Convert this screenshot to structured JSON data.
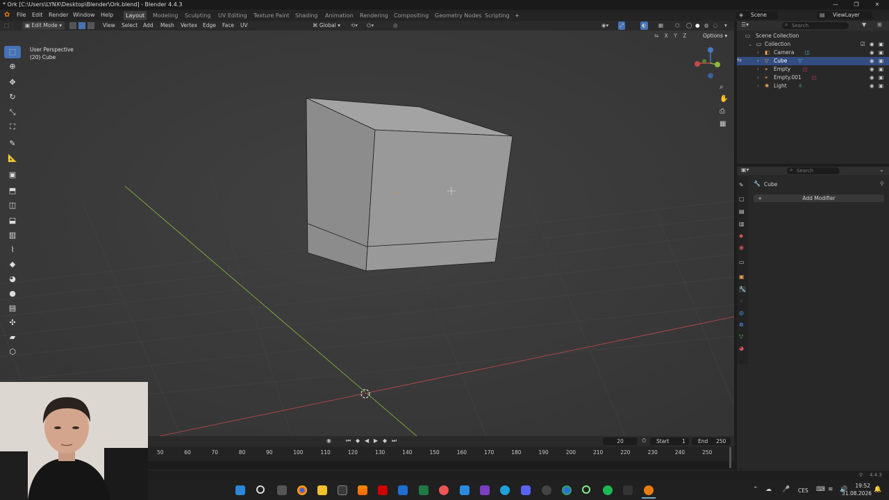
{
  "window": {
    "title": "* Ork [C:\\Users\\LYNX\\Desktop\\Blender\\Ork.blend] - Blender 4.4.3",
    "controls": [
      "—",
      "❐",
      "✕"
    ]
  },
  "menu": [
    "File",
    "Edit",
    "Render",
    "Window",
    "Help"
  ],
  "workspaces": [
    "Layout",
    "Modeling",
    "Sculpting",
    "UV Editing",
    "Texture Paint",
    "Shading",
    "Animation",
    "Rendering",
    "Compositing",
    "Geometry Nodes",
    "Scripting"
  ],
  "active_workspace": "Layout",
  "scene": {
    "name": "Scene",
    "viewlayer": "ViewLayer"
  },
  "viewport_header": {
    "mode": "Edit Mode",
    "menus": [
      "View",
      "Select",
      "Add",
      "Mesh",
      "Vertex",
      "Edge",
      "Face",
      "UV"
    ],
    "orientation": "Global",
    "axes": [
      "X",
      "Y",
      "Z"
    ],
    "options": "Options"
  },
  "viewport": {
    "perspective": "User Perspective",
    "object_info": "(20) Cube"
  },
  "outliner": {
    "search_placeholder": "Search",
    "root": "Scene Collection",
    "collection": "Collection",
    "items": [
      "Camera",
      "Cube",
      "Empty",
      "Empty.001",
      "Light"
    ],
    "selected": "Cube"
  },
  "properties": {
    "search_placeholder": "Search",
    "object": "Cube",
    "add_modifier": "Add Modifier"
  },
  "timeline": {
    "current_frame": "20",
    "start_label": "Start",
    "start": "1",
    "end_label": "End",
    "end": "250",
    "ticks": [
      "50",
      "60",
      "70",
      "80",
      "90",
      "100",
      "110",
      "120",
      "130",
      "140",
      "150",
      "160",
      "170",
      "180",
      "190",
      "200",
      "210",
      "220",
      "230",
      "240",
      "250"
    ]
  },
  "statusbar": {
    "version": "4.4.3"
  },
  "taskbar": {
    "language": "CES",
    "time": "19:52",
    "date": "31.08.2026"
  },
  "colors": {
    "accent": "#4772b3",
    "selected_row": "#334d80",
    "viewport_bg": "#3c3c3c",
    "x_axis": "#c44a4a",
    "y_axis": "#8ab93a"
  }
}
